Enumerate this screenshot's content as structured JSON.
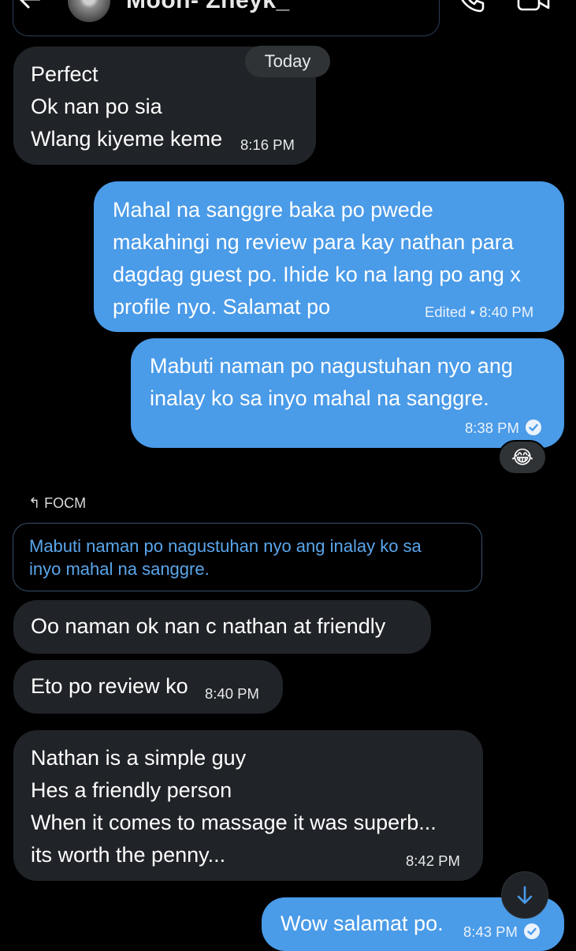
{
  "header": {
    "contact_name": "Moon- Zheyk_",
    "icons": [
      "back-arrow-icon",
      "avatar",
      "phone-icon",
      "video-camera-icon"
    ]
  },
  "date_separator": "Today",
  "messages": [
    {
      "id": "m1",
      "direction": "in",
      "lines": [
        "Perfect",
        "Ok nan po sia",
        "Wlang kiyeme keme"
      ],
      "time": "8:16 PM"
    },
    {
      "id": "m2",
      "direction": "out",
      "lines": [
        "Mahal na sanggre baka po pwede",
        "makahingi ng review para kay nathan para",
        "dagdag guest po. Ihide ko na lang po ang x",
        "profile nyo. Salamat po"
      ],
      "status": "Edited • 8:40 PM"
    },
    {
      "id": "m3",
      "direction": "out",
      "lines": [
        "Mabuti naman po nagustuhan nyo ang",
        "inalay ko sa inyo mahal na sanggre."
      ],
      "time": "8:38 PM",
      "read": true,
      "reaction": "😂"
    },
    {
      "id": "m4",
      "direction": "in",
      "reply_label": "FOCM",
      "quoted_lines": [
        "Mabuti naman po nagustuhan nyo ang inalay ko sa",
        "inyo mahal na sanggre."
      ],
      "lines": [
        "Oo naman ok nan c nathan at friendly"
      ]
    },
    {
      "id": "m5",
      "direction": "in",
      "lines": [
        "Eto po review ko"
      ],
      "time": "8:40 PM"
    },
    {
      "id": "m6",
      "direction": "in",
      "lines": [
        "Nathan is a simple guy",
        "Hes a friendly person",
        "When it comes to massage it was superb...",
        "its worth the penny..."
      ],
      "time": "8:42 PM"
    },
    {
      "id": "m7",
      "direction": "out",
      "lines": [
        "Wow salamat po."
      ],
      "time": "8:43 PM",
      "read": true
    }
  ],
  "colors": {
    "background": "#000000",
    "incoming_bubble": "#202327",
    "outgoing_bubble": "#4a9be8",
    "quote_text": "#5aa6ec"
  },
  "scroll_button_icon": "arrow-down-icon"
}
